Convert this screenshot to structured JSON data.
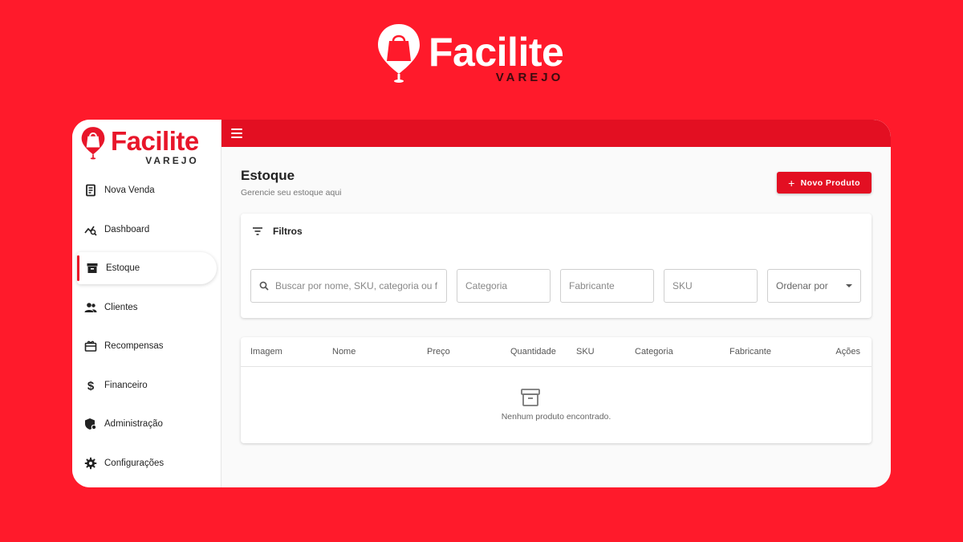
{
  "brand": {
    "name": "Facilite",
    "tagline": "VAREJO",
    "colors": {
      "primary": "#e30f22",
      "background": "#ff1a2b"
    }
  },
  "sidebar": {
    "items": [
      {
        "label": "Nova Venda",
        "icon": "receipt-icon"
      },
      {
        "label": "Dashboard",
        "icon": "chart-search-icon"
      },
      {
        "label": "Estoque",
        "icon": "archive-icon",
        "active": true
      },
      {
        "label": "Clientes",
        "icon": "users-icon"
      },
      {
        "label": "Recompensas",
        "icon": "gift-card-icon"
      },
      {
        "label": "Financeiro",
        "icon": "dollar-icon"
      },
      {
        "label": "Administração",
        "icon": "admin-shield-icon"
      },
      {
        "label": "Configurações",
        "icon": "gear-icon"
      }
    ]
  },
  "page": {
    "title": "Estoque",
    "subtitle": "Gerencie seu estoque aqui",
    "new_product_label": "Novo Produto"
  },
  "filters": {
    "title": "Filtros",
    "search_placeholder": "Buscar por nome, SKU, categoria ou f",
    "category_placeholder": "Categoria",
    "manufacturer_placeholder": "Fabricante",
    "sku_placeholder": "SKU",
    "sort_label": "Ordenar por"
  },
  "table": {
    "columns": [
      "Imagem",
      "Nome",
      "Preço",
      "Quantidade",
      "SKU",
      "Categoria",
      "Fabricante",
      "Ações"
    ],
    "empty_message": "Nenhum produto encontrado."
  }
}
